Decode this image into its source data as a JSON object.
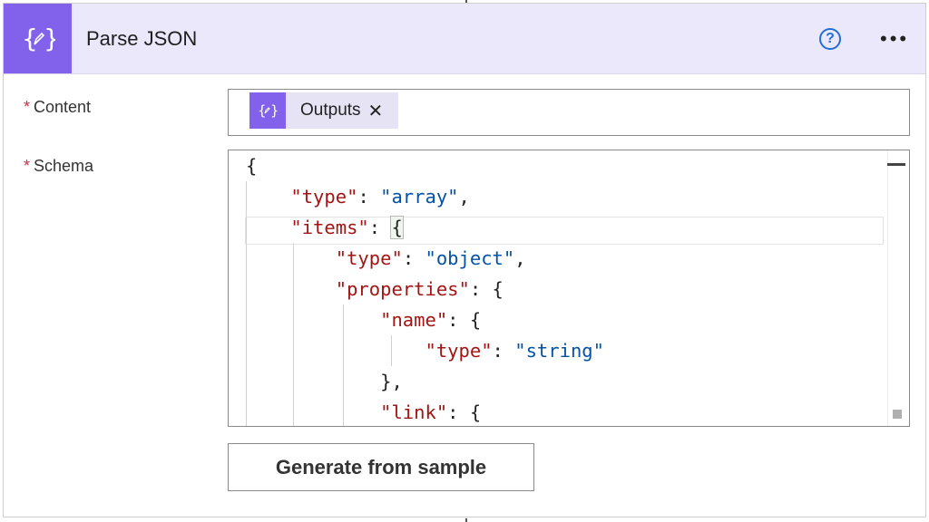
{
  "action": {
    "title": "Parse JSON",
    "icon": "expression-icon",
    "accent_color": "#8262ea",
    "header_bg": "#ece8fb"
  },
  "fields": {
    "required_marker": "*",
    "content": {
      "label": "Content",
      "token": {
        "label": "Outputs",
        "remove_glyph": "✕",
        "icon": "expression-icon"
      }
    },
    "schema": {
      "label": "Schema",
      "code_lines": [
        {
          "key": "",
          "value": "",
          "text": "{"
        },
        {
          "key": "\"type\"",
          "value": "\"array\"",
          "trail": ","
        },
        {
          "key": "\"items\"",
          "value": "",
          "trail": "{"
        },
        {
          "key": "\"type\"",
          "value": "\"object\"",
          "trail": ","
        },
        {
          "key": "\"properties\"",
          "value": "",
          "trail": "{"
        },
        {
          "key": "\"name\"",
          "value": "",
          "trail": "{"
        },
        {
          "key": "\"type\"",
          "value": "\"string\"",
          "trail": ""
        },
        {
          "key": "",
          "value": "",
          "text": "},"
        },
        {
          "key": "\"link\"",
          "value": "",
          "trail": "{"
        }
      ]
    }
  },
  "buttons": {
    "generate_label": "Generate from sample"
  },
  "icons": {
    "help": "help-circle-icon",
    "more": "more-horizontal-icon"
  }
}
